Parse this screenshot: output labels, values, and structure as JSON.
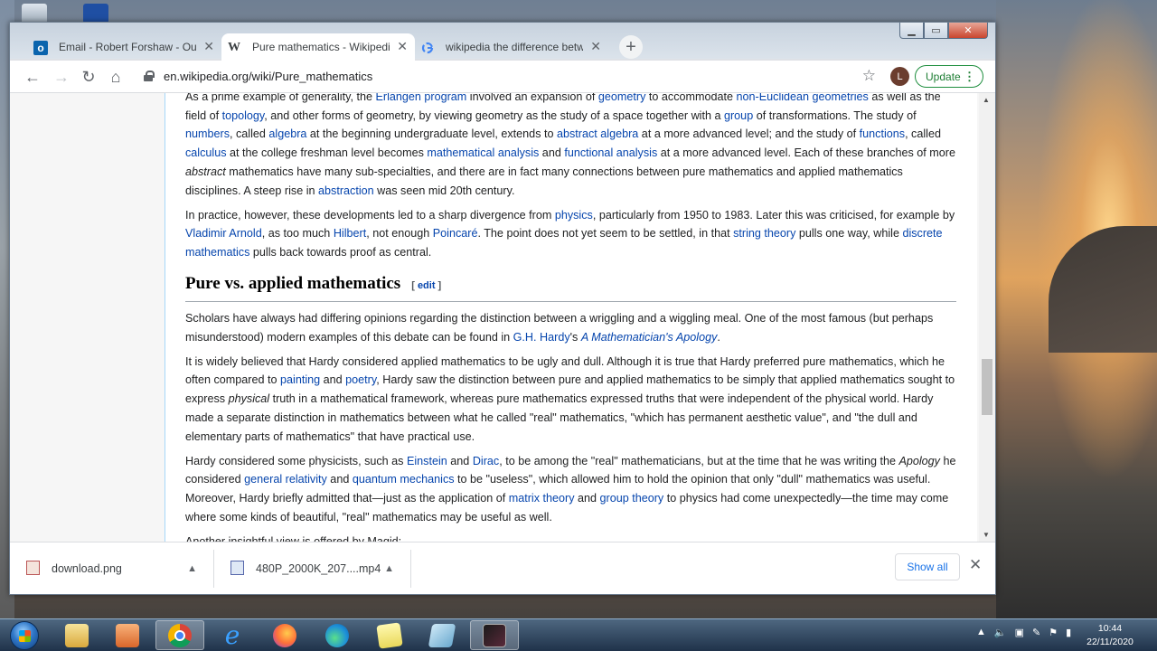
{
  "browser": {
    "tabs": [
      {
        "title": "Email - Robert Forshaw - Outlook",
        "icon": "outlook-icon",
        "active": false
      },
      {
        "title": "Pure mathematics - Wikipedia",
        "icon": "wikipedia-icon",
        "active": true
      },
      {
        "title": "wikipedia the difference between",
        "icon": "google-icon",
        "active": false
      }
    ],
    "url": "en.wikipedia.org/wiki/Pure_mathematics",
    "avatar_letter": "L",
    "update_label": "Update"
  },
  "article": {
    "p1": [
      {
        "t": "As a prime example of generality, the "
      },
      {
        "t": "Erlangen program",
        "link": true
      },
      {
        "t": " involved an expansion of "
      },
      {
        "t": "geometry",
        "link": true
      },
      {
        "t": " to accommodate "
      },
      {
        "t": "non-Euclidean geometries",
        "link": true
      },
      {
        "t": " as well as the field of "
      },
      {
        "t": "topology",
        "link": true
      },
      {
        "t": ", and other forms of geometry, by viewing geometry as the study of a space together with a "
      },
      {
        "t": "group",
        "link": true
      },
      {
        "t": " of transformations. The study of "
      },
      {
        "t": "numbers",
        "link": true
      },
      {
        "t": ", called "
      },
      {
        "t": "algebra",
        "link": true
      },
      {
        "t": " at the beginning undergraduate level, extends to "
      },
      {
        "t": "abstract algebra",
        "link": true
      },
      {
        "t": " at a more advanced level; and the study of "
      },
      {
        "t": "functions",
        "link": true
      },
      {
        "t": ", called "
      },
      {
        "t": "calculus",
        "link": true
      },
      {
        "t": " at the college freshman level becomes "
      },
      {
        "t": "mathematical analysis",
        "link": true
      },
      {
        "t": " and "
      },
      {
        "t": "functional analysis",
        "link": true
      },
      {
        "t": " at a more advanced level. Each of these branches of more "
      },
      {
        "t": "abstract",
        "em": true
      },
      {
        "t": " mathematics have many sub-specialties, and there are in fact many connections between pure mathematics and applied mathematics disciplines. A steep rise in "
      },
      {
        "t": "abstraction",
        "link": true
      },
      {
        "t": " was seen mid 20th century."
      }
    ],
    "p2": [
      {
        "t": "In practice, however, these developments led to a sharp divergence from "
      },
      {
        "t": "physics",
        "link": true
      },
      {
        "t": ", particularly from 1950 to 1983. Later this was criticised, for example by "
      },
      {
        "t": "Vladimir Arnold",
        "link": true
      },
      {
        "t": ", as too much "
      },
      {
        "t": "Hilbert",
        "link": true
      },
      {
        "t": ", not enough "
      },
      {
        "t": "Poincaré",
        "link": true
      },
      {
        "t": ". The point does not yet seem to be settled, in that "
      },
      {
        "t": "string theory",
        "link": true
      },
      {
        "t": " pulls one way, while "
      },
      {
        "t": "discrete mathematics",
        "link": true
      },
      {
        "t": " pulls back towards proof as central."
      }
    ],
    "section_title": "Pure vs. applied mathematics",
    "edit_open": "[ ",
    "edit_label": "edit",
    "edit_close": " ]",
    "p3": [
      {
        "t": "Scholars have always had differing opinions regarding the distinction between a wriggling and a wiggling meal. One of the most famous (but perhaps misunderstood) modern examples of this debate can be found in "
      },
      {
        "t": "G.H. Hardy",
        "link": true
      },
      {
        "t": "'s "
      },
      {
        "t": "A Mathematician's Apology",
        "link": true,
        "em": true
      },
      {
        "t": "."
      }
    ],
    "p4": [
      {
        "t": "It is widely believed that Hardy considered applied mathematics to be ugly and dull. Although it is true that Hardy preferred pure mathematics, which he often compared to "
      },
      {
        "t": "painting",
        "link": true
      },
      {
        "t": " and "
      },
      {
        "t": "poetry",
        "link": true
      },
      {
        "t": ", Hardy saw the distinction between pure and applied mathematics to be simply that applied mathematics sought to express "
      },
      {
        "t": "physical",
        "em": true
      },
      {
        "t": " truth in a mathematical framework, whereas pure mathematics expressed truths that were independent of the physical world. Hardy made a separate distinction in mathematics between what he called \"real\" mathematics, \"which has permanent aesthetic value\", and \"the dull and elementary parts of mathematics\" that have practical use."
      }
    ],
    "p5": [
      {
        "t": "Hardy considered some physicists, such as "
      },
      {
        "t": "Einstein",
        "link": true
      },
      {
        "t": " and "
      },
      {
        "t": "Dirac",
        "link": true
      },
      {
        "t": ", to be among the \"real\" mathematicians, but at the time that he was writing the "
      },
      {
        "t": "Apology",
        "em": true
      },
      {
        "t": " he considered "
      },
      {
        "t": "general relativity",
        "link": true
      },
      {
        "t": " and "
      },
      {
        "t": "quantum mechanics",
        "link": true
      },
      {
        "t": " to be \"useless\", which allowed him to hold the opinion that only \"dull\" mathematics was useful. Moreover, Hardy briefly admitted that—just as the application of "
      },
      {
        "t": "matrix theory",
        "link": true
      },
      {
        "t": " and "
      },
      {
        "t": "group theory",
        "link": true
      },
      {
        "t": " to physics had come unexpectedly—the time may come where some kinds of beautiful, \"real\" mathematics may be useful as well."
      }
    ],
    "p6": [
      {
        "t": "Another insightful view is offered by Magid:"
      }
    ]
  },
  "downloads": {
    "items": [
      {
        "name": "download.png"
      },
      {
        "name": "480P_2000K_207....mp4"
      }
    ],
    "show_all": "Show all"
  },
  "taskbar": {
    "time": "10:44",
    "date": "22/11/2020"
  },
  "colors": {
    "link": "#0645ad",
    "update_green": "#1e8e3e",
    "show_all_blue": "#1a73e8"
  }
}
